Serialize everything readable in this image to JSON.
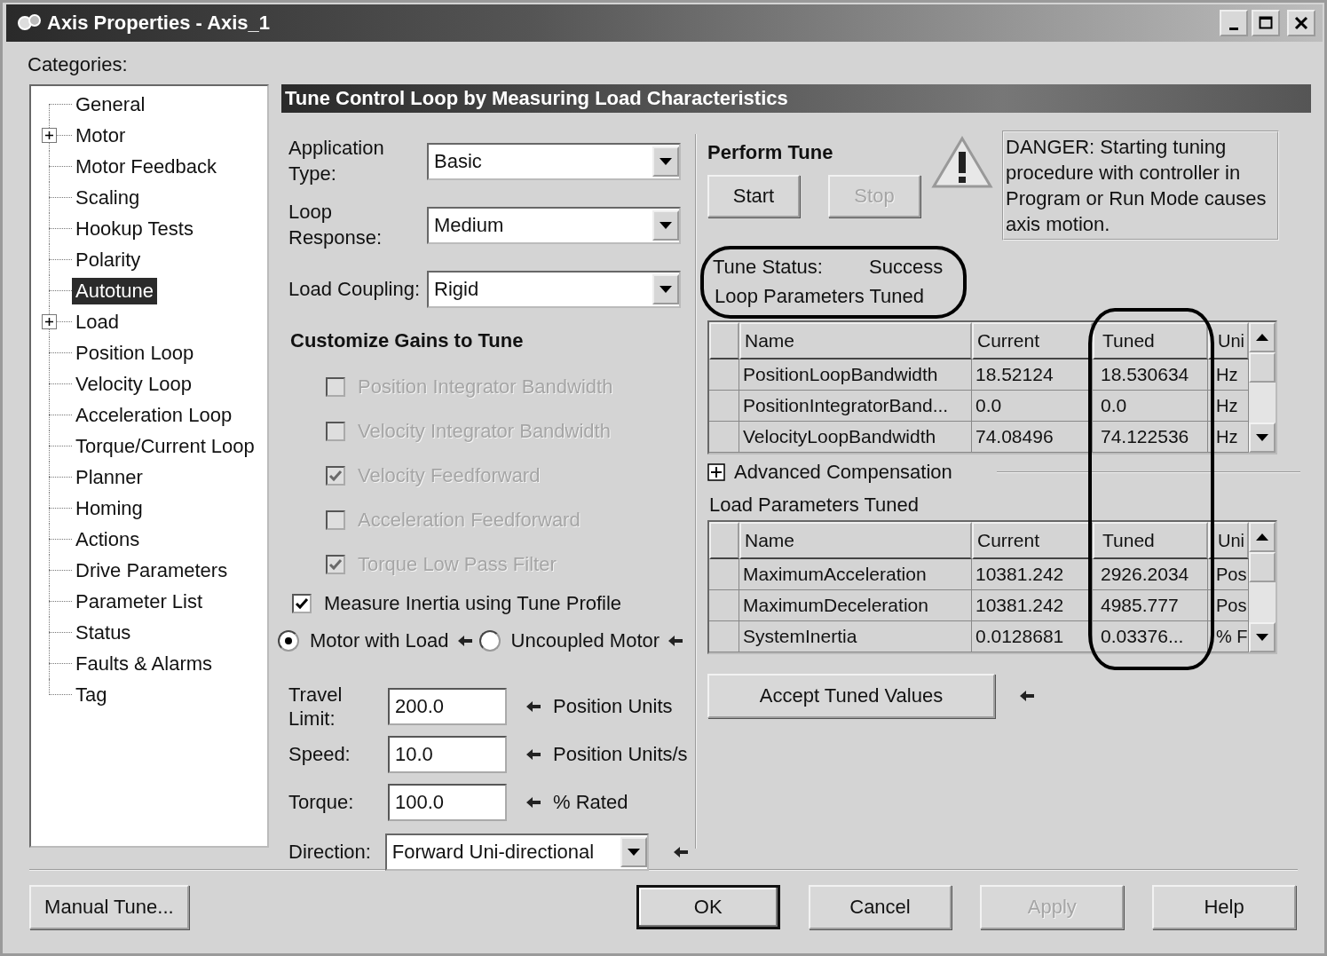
{
  "window": {
    "title": "Axis Properties - Axis_1"
  },
  "categories_label": "Categories:",
  "tree": [
    {
      "label": "General",
      "expandable": false,
      "selected": false
    },
    {
      "label": "Motor",
      "expandable": true,
      "selected": false
    },
    {
      "label": "Motor Feedback",
      "expandable": false,
      "selected": false
    },
    {
      "label": "Scaling",
      "expandable": false,
      "selected": false
    },
    {
      "label": "Hookup Tests",
      "expandable": false,
      "selected": false
    },
    {
      "label": "Polarity",
      "expandable": false,
      "selected": false
    },
    {
      "label": "Autotune",
      "expandable": false,
      "selected": true
    },
    {
      "label": "Load",
      "expandable": true,
      "selected": false
    },
    {
      "label": "Position Loop",
      "expandable": false,
      "selected": false
    },
    {
      "label": "Velocity Loop",
      "expandable": false,
      "selected": false
    },
    {
      "label": "Acceleration Loop",
      "expandable": false,
      "selected": false
    },
    {
      "label": "Torque/Current Loop",
      "expandable": false,
      "selected": false
    },
    {
      "label": "Planner",
      "expandable": false,
      "selected": false
    },
    {
      "label": "Homing",
      "expandable": false,
      "selected": false
    },
    {
      "label": "Actions",
      "expandable": false,
      "selected": false
    },
    {
      "label": "Drive Parameters",
      "expandable": false,
      "selected": false
    },
    {
      "label": "Parameter List",
      "expandable": false,
      "selected": false
    },
    {
      "label": "Status",
      "expandable": false,
      "selected": false
    },
    {
      "label": "Faults & Alarms",
      "expandable": false,
      "selected": false
    },
    {
      "label": "Tag",
      "expandable": false,
      "selected": false
    }
  ],
  "panel_title": "Tune Control Loop by Measuring Load Characteristics",
  "settings": [
    {
      "label": "Application Type:",
      "value": "Basic"
    },
    {
      "label": "Loop Response:",
      "value": "Medium"
    },
    {
      "label": "Load Coupling:",
      "value": "Rigid"
    }
  ],
  "gains_title": "Customize Gains to Tune",
  "gains": [
    {
      "label": "Position Integrator Bandwidth",
      "checked": false,
      "disabled": true
    },
    {
      "label": "Velocity Integrator Bandwidth",
      "checked": false,
      "disabled": true
    },
    {
      "label": "Velocity Feedforward",
      "checked": true,
      "disabled": true
    },
    {
      "label": "Acceleration Feedforward",
      "checked": false,
      "disabled": true
    },
    {
      "label": "Torque Low Pass Filter",
      "checked": true,
      "disabled": true
    }
  ],
  "measure_inertia": {
    "label": "Measure Inertia using Tune Profile",
    "checked": true
  },
  "load_options": [
    {
      "label": "Motor with Load",
      "selected": true
    },
    {
      "label": "Uncoupled Motor",
      "selected": false
    }
  ],
  "tune_inputs": [
    {
      "label": "Travel Limit:",
      "value": "200.0",
      "unit": "Position Units"
    },
    {
      "label": "Speed:",
      "value": "10.0",
      "unit": "Position Units/s"
    },
    {
      "label": "Torque:",
      "value": "100.0",
      "unit": "% Rated"
    }
  ],
  "direction": {
    "label": "Direction:",
    "value": "Forward Uni-directional"
  },
  "perform_tune": {
    "title": "Perform Tune",
    "buttons": [
      {
        "label": "Start",
        "disabled": false
      },
      {
        "label": "Stop",
        "disabled": true
      }
    ],
    "warning": "DANGER: Starting tuning procedure with controller in Program or Run Mode causes axis motion."
  },
  "tune_status": {
    "label": "Tune Status:",
    "value": "Success"
  },
  "loop_parameters": {
    "title": "Loop Parameters Tuned",
    "columns": [
      "Name",
      "Current",
      "Tuned",
      "Uni"
    ],
    "rows": [
      {
        "name": "PositionLoopBandwidth",
        "current": "18.52124",
        "tuned": "18.530634",
        "unit": "Hz"
      },
      {
        "name": "PositionIntegratorBand...",
        "current": "0.0",
        "tuned": "0.0",
        "unit": "Hz"
      },
      {
        "name": "VelocityLoopBandwidth",
        "current": "74.08496",
        "tuned": "74.122536",
        "unit": "Hz"
      }
    ]
  },
  "advanced": {
    "label": "Advanced Compensation",
    "expanded": false
  },
  "load_parameters": {
    "title": "Load Parameters Tuned",
    "columns": [
      "Name",
      "Current",
      "Tuned",
      "Uni"
    ],
    "rows": [
      {
        "name": "MaximumAcceleration",
        "current": "10381.242",
        "tuned": "2926.2034",
        "unit": "Pos"
      },
      {
        "name": "MaximumDeceleration",
        "current": "10381.242",
        "tuned": "4985.777",
        "unit": "Pos"
      },
      {
        "name": "SystemInertia",
        "current": "0.0128681",
        "tuned": "0.03376...",
        "unit": "% F"
      }
    ]
  },
  "accept_button": "Accept Tuned Values",
  "footer_buttons": [
    {
      "label": "Manual Tune...",
      "default": false,
      "disabled": false
    },
    {
      "label": "OK",
      "default": true,
      "disabled": false
    },
    {
      "label": "Cancel",
      "default": false,
      "disabled": false
    },
    {
      "label": "Apply",
      "default": false,
      "disabled": true
    },
    {
      "label": "Help",
      "default": false,
      "disabled": false
    }
  ]
}
